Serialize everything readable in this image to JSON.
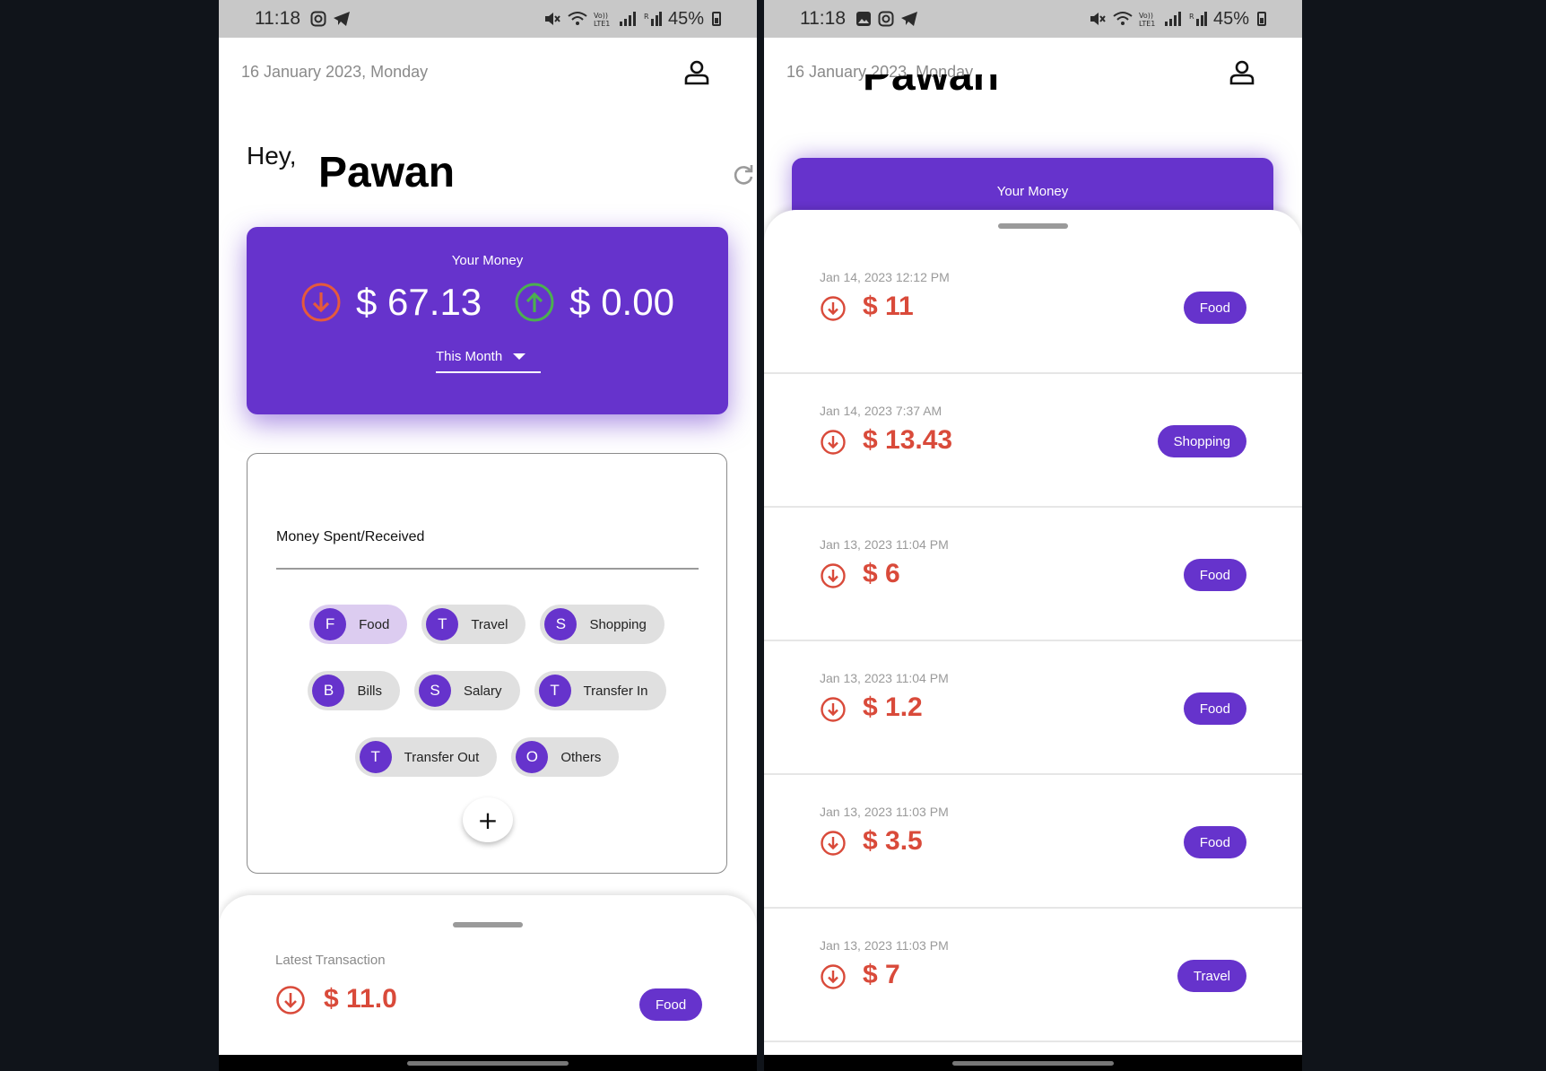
{
  "status_bar": {
    "time": "11:18",
    "battery": "45%"
  },
  "header": {
    "date": "16 January 2023, Monday"
  },
  "greeting": {
    "hey": "Hey,",
    "name": "Pawan"
  },
  "money_card": {
    "title": "Your Money",
    "spent": "$ 67.13",
    "received": "$ 0.00",
    "period": "This Month"
  },
  "entry": {
    "label": "Money Spent/Received",
    "categories": [
      {
        "letter": "F",
        "label": "Food",
        "selected": true
      },
      {
        "letter": "T",
        "label": "Travel"
      },
      {
        "letter": "S",
        "label": "Shopping"
      },
      {
        "letter": "B",
        "label": "Bills"
      },
      {
        "letter": "S",
        "label": "Salary"
      },
      {
        "letter": "T",
        "label": "Transfer In"
      },
      {
        "letter": "T",
        "label": "Transfer Out"
      },
      {
        "letter": "O",
        "label": "Others"
      }
    ],
    "add_label": "+"
  },
  "latest": {
    "label": "Latest Transaction",
    "amount": "$ 11.0",
    "tag": "Food"
  },
  "transactions": [
    {
      "date": "Jan 14, 2023 12:12 PM",
      "amount": "$ 11",
      "tag": "Food"
    },
    {
      "date": "Jan 14, 2023 7:37 AM",
      "amount": "$ 13.43",
      "tag": "Shopping"
    },
    {
      "date": "Jan 13, 2023 11:04 PM",
      "amount": "$ 6",
      "tag": "Food"
    },
    {
      "date": "Jan 13, 2023 11:04 PM",
      "amount": "$ 1.2",
      "tag": "Food"
    },
    {
      "date": "Jan 13, 2023 11:03 PM",
      "amount": "$ 3.5",
      "tag": "Food"
    },
    {
      "date": "Jan 13, 2023 11:03 PM",
      "amount": "$ 7",
      "tag": "Travel"
    }
  ],
  "colors": {
    "accent": "#6633cc",
    "expense_red": "#d94a3a",
    "income_green": "#4caf50",
    "chip_bg": "#e0e0e0",
    "chip_selected_bg": "#dcccf0"
  },
  "icons": {
    "profile": "person-outline-icon",
    "refresh": "refresh-icon",
    "expense": "arrow-down-circle-icon",
    "income": "arrow-up-circle-icon"
  }
}
